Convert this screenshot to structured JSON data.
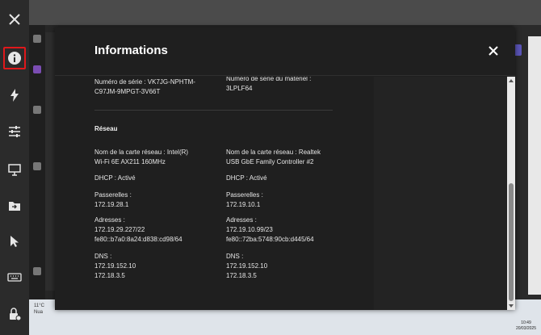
{
  "dialog": {
    "title": "Informations",
    "serial": {
      "left_label": "Numéro de série : VK7JG-NPHTM-",
      "left_value": "C97JM-9MPGT-3V66T",
      "right_label": "Numéro de série du matériel :",
      "right_value": "3LPLF64"
    },
    "network": {
      "section_title": "Réseau",
      "columns": [
        {
          "adapter_line1": "Nom de la carte réseau : Intel(R)",
          "adapter_line2": "Wi-Fi 6E AX211 160MHz",
          "dhcp": "DHCP : Activé",
          "gateways_label": "Passerelles :",
          "gateways_value": "172.19.28.1",
          "addresses_label": "Adresses :",
          "address1": "172.19.29.227/22",
          "address2": "fe80::b7a0:8a24:d838:cd98/64",
          "dns_label": "DNS :",
          "dns1": "172.19.152.10",
          "dns2": "172.18.3.5"
        },
        {
          "adapter_line1": "Nom de la carte réseau : Realtek",
          "adapter_line2": "USB GbE Family Controller #2",
          "dhcp": "DHCP : Activé",
          "gateways_label": "Passerelles :",
          "gateways_value": "172.19.10.1",
          "addresses_label": "Adresses :",
          "address1": "172.19.10.99/23",
          "address2": "fe80::72ba:5748:90cb:d445/64",
          "dns_label": "DNS :",
          "dns1": "172.19.152.10",
          "dns2": "172.18.3.5"
        }
      ]
    }
  },
  "toolbar": {
    "items": [
      "close-icon",
      "info-icon",
      "lightning-icon",
      "sliders-icon",
      "monitor-icon",
      "file-transfer-icon",
      "pointer-icon",
      "keyboard-icon",
      "lock-icon"
    ],
    "accent": "#e0181b"
  },
  "taskbar": {
    "weather_temp": "11°C",
    "weather_text": "Nua",
    "time": "10:49",
    "date": "20/03/2025"
  }
}
